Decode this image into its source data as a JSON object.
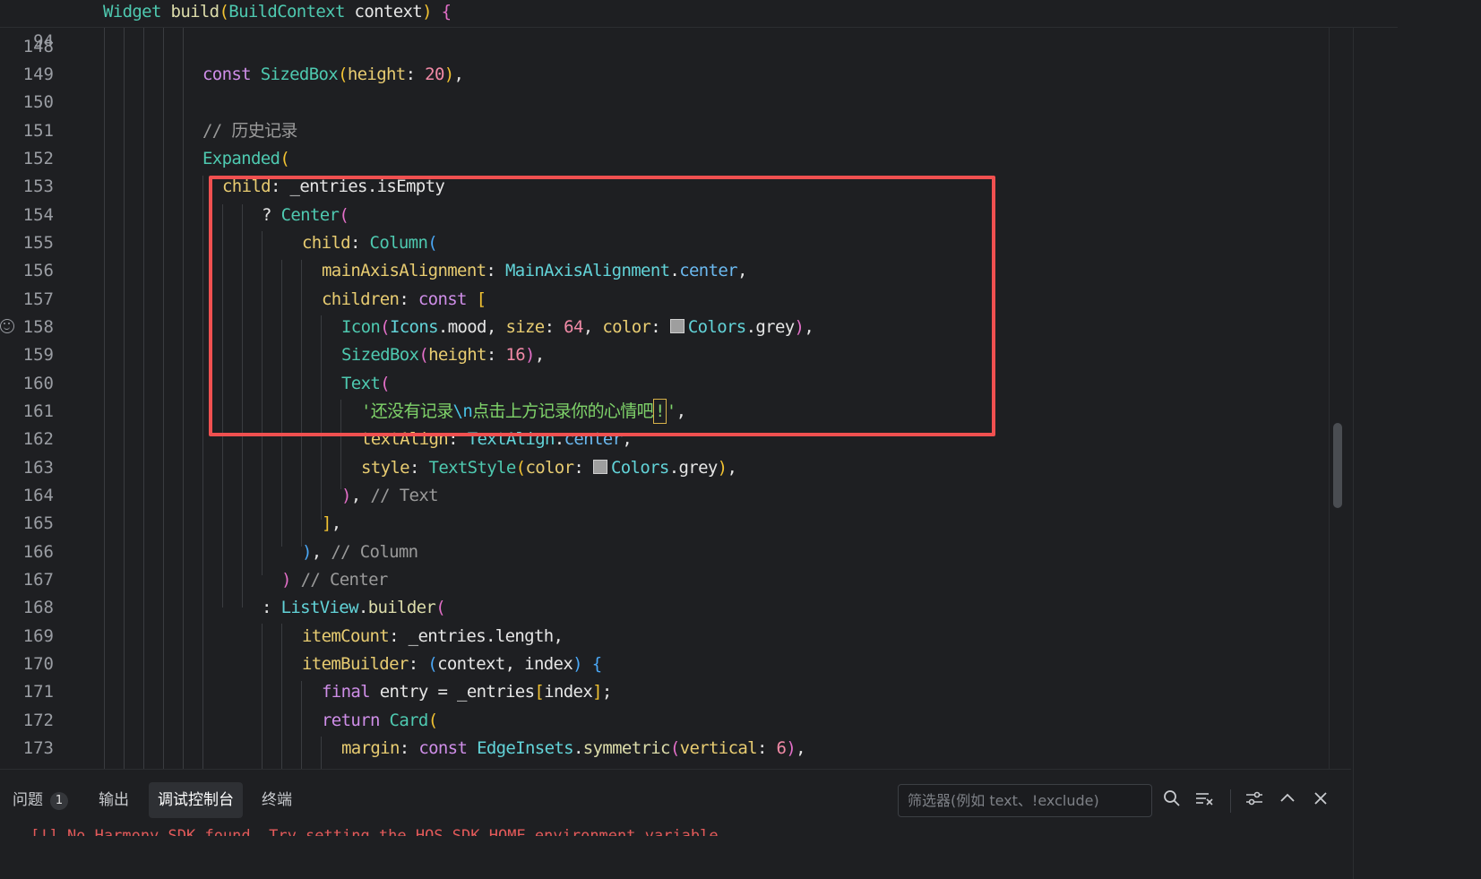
{
  "editor": {
    "sticky": {
      "line": "94",
      "code": "Widget build(BuildContext context) {"
    },
    "lines": [
      {
        "n": "148"
      },
      {
        "n": "149"
      },
      {
        "n": "150"
      },
      {
        "n": "151"
      },
      {
        "n": "152"
      },
      {
        "n": "153"
      },
      {
        "n": "154"
      },
      {
        "n": "155"
      },
      {
        "n": "156"
      },
      {
        "n": "157"
      },
      {
        "n": "158"
      },
      {
        "n": "159"
      },
      {
        "n": "160"
      },
      {
        "n": "161"
      },
      {
        "n": "162"
      },
      {
        "n": "163"
      },
      {
        "n": "164"
      },
      {
        "n": "165"
      },
      {
        "n": "166"
      },
      {
        "n": "167"
      },
      {
        "n": "168"
      },
      {
        "n": "169"
      },
      {
        "n": "170"
      },
      {
        "n": "171"
      },
      {
        "n": "172"
      },
      {
        "n": "173"
      }
    ],
    "code": {
      "l149": [
        "const",
        "SizedBox",
        "(",
        "height",
        ": ",
        "20",
        ")",
        ","
      ],
      "l151": "// 历史记录",
      "l152": [
        "Expanded",
        "("
      ],
      "l153": [
        "child",
        ": _entries.isEmpty"
      ],
      "l154": [
        "? ",
        "Center",
        "("
      ],
      "l155": [
        "child",
        ": ",
        "Column",
        "("
      ],
      "l156": [
        "mainAxisAlignment",
        ": ",
        "MainAxisAlignment",
        ".",
        "center",
        ","
      ],
      "l157": [
        "children",
        ": ",
        "const",
        " ",
        "["
      ],
      "l158": [
        "Icon",
        "(",
        "Icons",
        ".mood, ",
        "size",
        ": ",
        "64",
        ", ",
        "color",
        ": ",
        "Colors",
        ".grey",
        ")",
        ","
      ],
      "l159": [
        "SizedBox",
        "(",
        "height",
        ": ",
        "16",
        ")",
        ","
      ],
      "l160": [
        "Text",
        "("
      ],
      "l161": [
        "'还没有记录",
        "\\n",
        "点击上方记录你的心情吧",
        "!",
        "'",
        ","
      ],
      "l162": [
        "textAlign",
        ": ",
        "TextAlign",
        ".",
        "center",
        ","
      ],
      "l163": [
        "style",
        ": ",
        "TextStyle",
        "(",
        "color",
        ": ",
        "Colors",
        ".grey",
        ")",
        ","
      ],
      "l164": [
        ")",
        ", ",
        "// Text"
      ],
      "l165": [
        "]",
        ","
      ],
      "l166": [
        ")",
        ", ",
        "// Column"
      ],
      "l167": [
        ")",
        " ",
        "// Center"
      ],
      "l168": [
        ": ",
        "ListView",
        ".",
        "builder",
        "("
      ],
      "l169": [
        "itemCount",
        ": _entries.length,"
      ],
      "l170": [
        "itemBuilder",
        ": ",
        "(",
        "context, index",
        ")",
        " ",
        "{"
      ],
      "l171": [
        "final",
        " entry = _entries",
        "[",
        "index",
        "]",
        ";"
      ],
      "l172": [
        "return",
        " ",
        "Card",
        "("
      ],
      "l173": [
        "margin",
        ": ",
        "const",
        " ",
        "EdgeInsets",
        ".",
        "symmetric",
        "(",
        "vertical",
        ": ",
        "6",
        ")",
        ","
      ]
    }
  },
  "panel": {
    "tabs": [
      {
        "label": "问题",
        "badge": "1"
      },
      {
        "label": "输出"
      },
      {
        "label": "调试控制台"
      },
      {
        "label": "终端"
      }
    ],
    "active_tab": "调试控制台",
    "filter_placeholder": "筛选器(例如 text、!exclude)",
    "console_text": "[!] No Harmony SDK found. Try setting the HOS_SDK_HOME environment variable."
  },
  "colors": {
    "highlight": "#f05050",
    "string": "#7fd36a",
    "keyword": "#c586c0",
    "background": "#1e1f22"
  }
}
